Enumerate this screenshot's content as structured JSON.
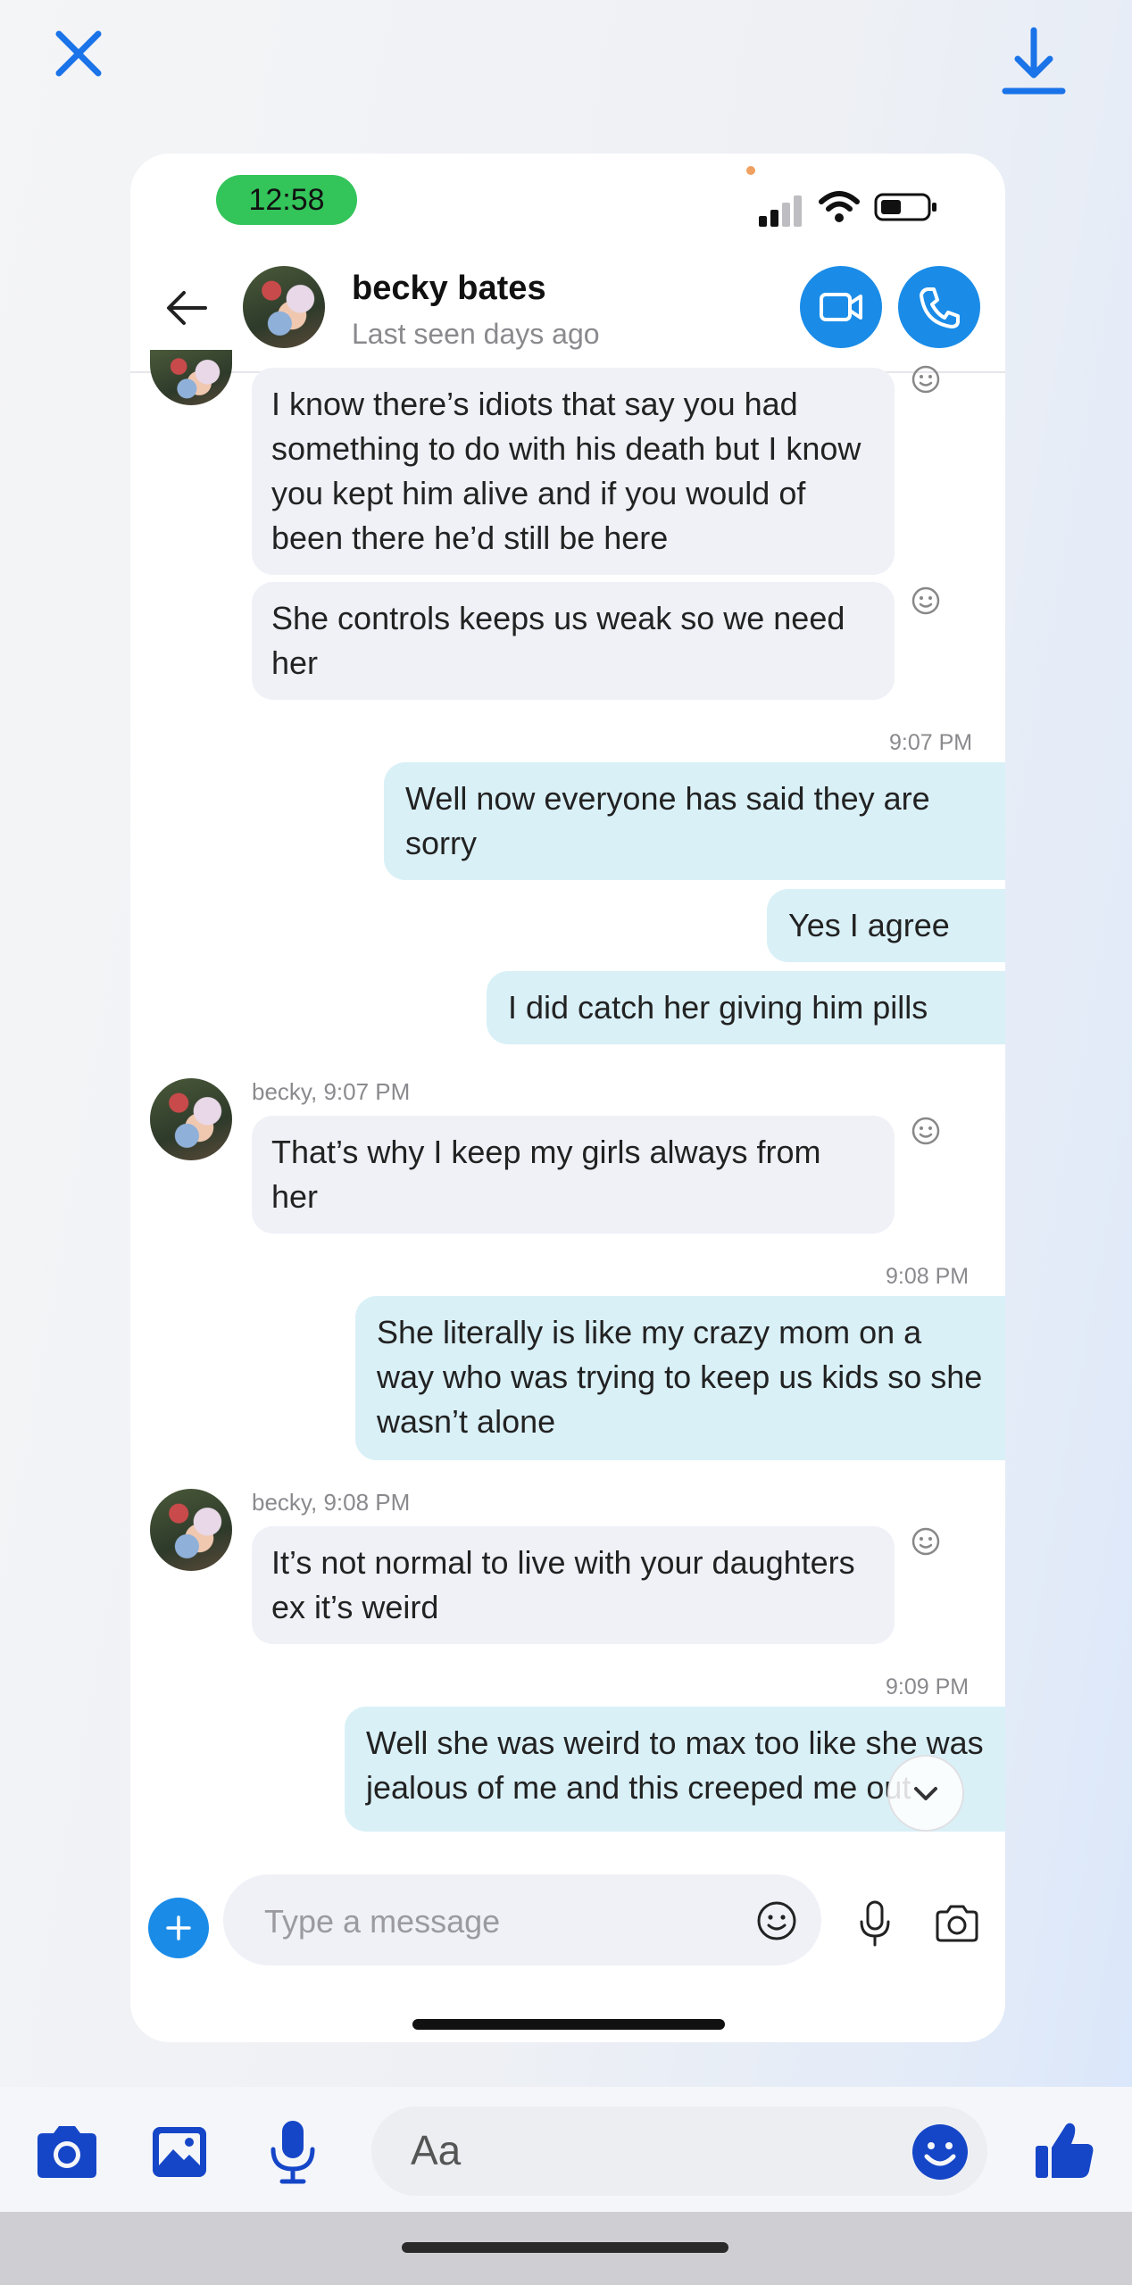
{
  "viewer": {
    "close_icon": "close-icon",
    "download_icon": "download-icon",
    "accent": "#1a73e8"
  },
  "status_bar": {
    "time": "12:58"
  },
  "header": {
    "name": "becky bates",
    "last_seen": "Last seen days ago",
    "accent": "#1a8ce8"
  },
  "messages": {
    "m1": "I know there’s idiots that say you had something to do with his death but I know you kept him alive and if you would of been there he’d still be here",
    "m2": "She controls keeps us weak so we need her",
    "ts1": "9:07 PM",
    "m3": "Well now everyone has said they are sorry",
    "m4": "Yes I agree",
    "m5": "I did catch her giving him pills",
    "sender1": "becky, 9:07 PM",
    "m6": "That’s why I keep my girls always from her",
    "ts2": "9:08 PM",
    "m7": "She literally is like my crazy mom on a way who was trying to keep us kids so she wasn’t alone",
    "sender2": "becky, 9:08 PM",
    "m8": "It’s not normal to live with your daughters ex it’s weird",
    "ts3": "9:09 PM",
    "m9": "Well she was weird to max too like she was jealous of me and this creeped me out"
  },
  "composer": {
    "placeholder": "Type a message"
  },
  "bottom_bar": {
    "placeholder": "Aa"
  }
}
